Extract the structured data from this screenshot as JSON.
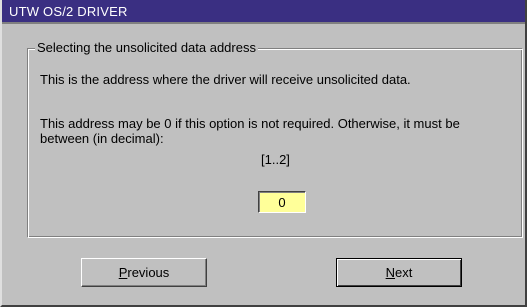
{
  "window": {
    "title": "UTW OS/2 DRIVER"
  },
  "group": {
    "legend": "Selecting the unsolicited data address",
    "description": "This is the address where the driver will receive unsolicited data.",
    "constraint": "This address may be 0 if this option is not required. Otherwise, it must be between (in decimal):",
    "range": "[1..2]",
    "address_value": "0"
  },
  "buttons": {
    "previous": {
      "mnemonic": "P",
      "rest": "revious"
    },
    "next": {
      "mnemonic": "N",
      "rest": "ext"
    }
  },
  "colors": {
    "titlebar": "#3a2f82",
    "face": "#c0c0c0",
    "input_bg": "#ffff99"
  }
}
